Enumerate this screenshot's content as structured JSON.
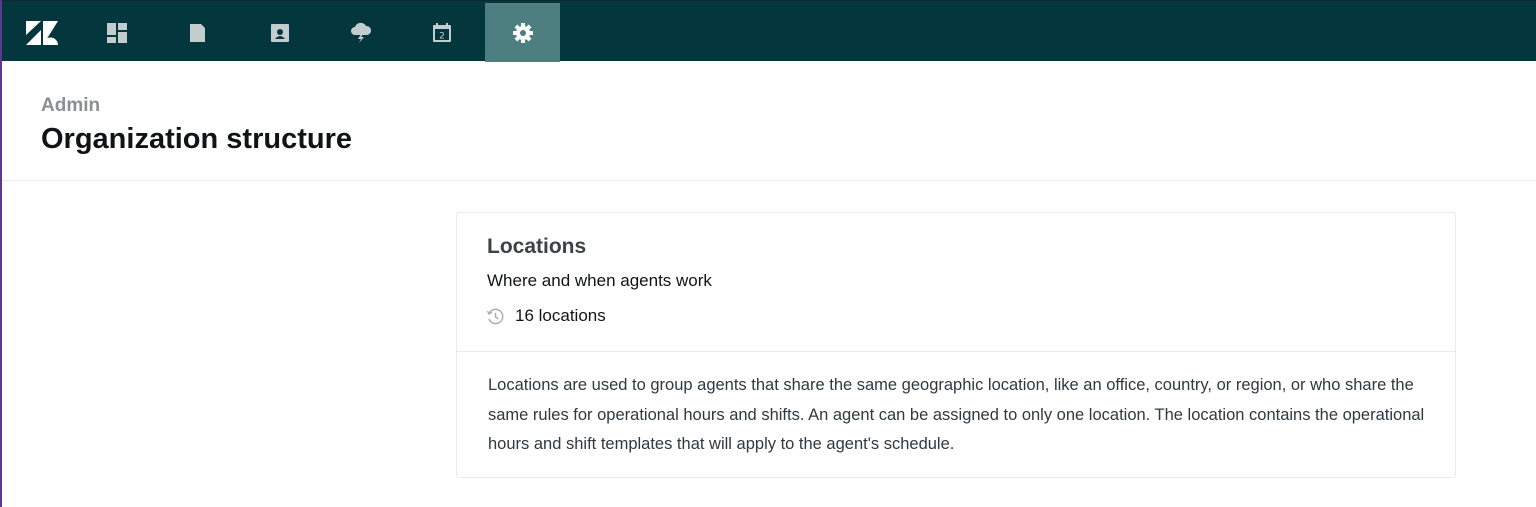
{
  "nav": {
    "logo_icon": "zendesk-logo-icon",
    "items": [
      {
        "icon": "dashboard-icon",
        "active": false
      },
      {
        "icon": "folder-icon",
        "active": false
      },
      {
        "icon": "contact-card-icon",
        "active": false
      },
      {
        "icon": "cloud-lightning-icon",
        "active": false
      },
      {
        "icon": "calendar-icon",
        "active": false
      },
      {
        "icon": "gear-icon",
        "active": true
      }
    ],
    "colors": {
      "background": "#03363d",
      "active_background": "#4d7f80",
      "icon": "#c3cdce",
      "active_icon": "#ffffff"
    }
  },
  "header": {
    "breadcrumb": "Admin",
    "title": "Organization structure"
  },
  "card": {
    "title": "Locations",
    "subtitle": "Where and when agents work",
    "meta_icon": "clock-history-icon",
    "count_label": "16 locations",
    "description": "Locations are used to group agents that share the same geographic location, like an office, country, or region, or who share the same rules for operational hours and shifts. An agent can be assigned to only one location. The location contains the operational hours and shift templates that will apply to the agent's schedule."
  }
}
